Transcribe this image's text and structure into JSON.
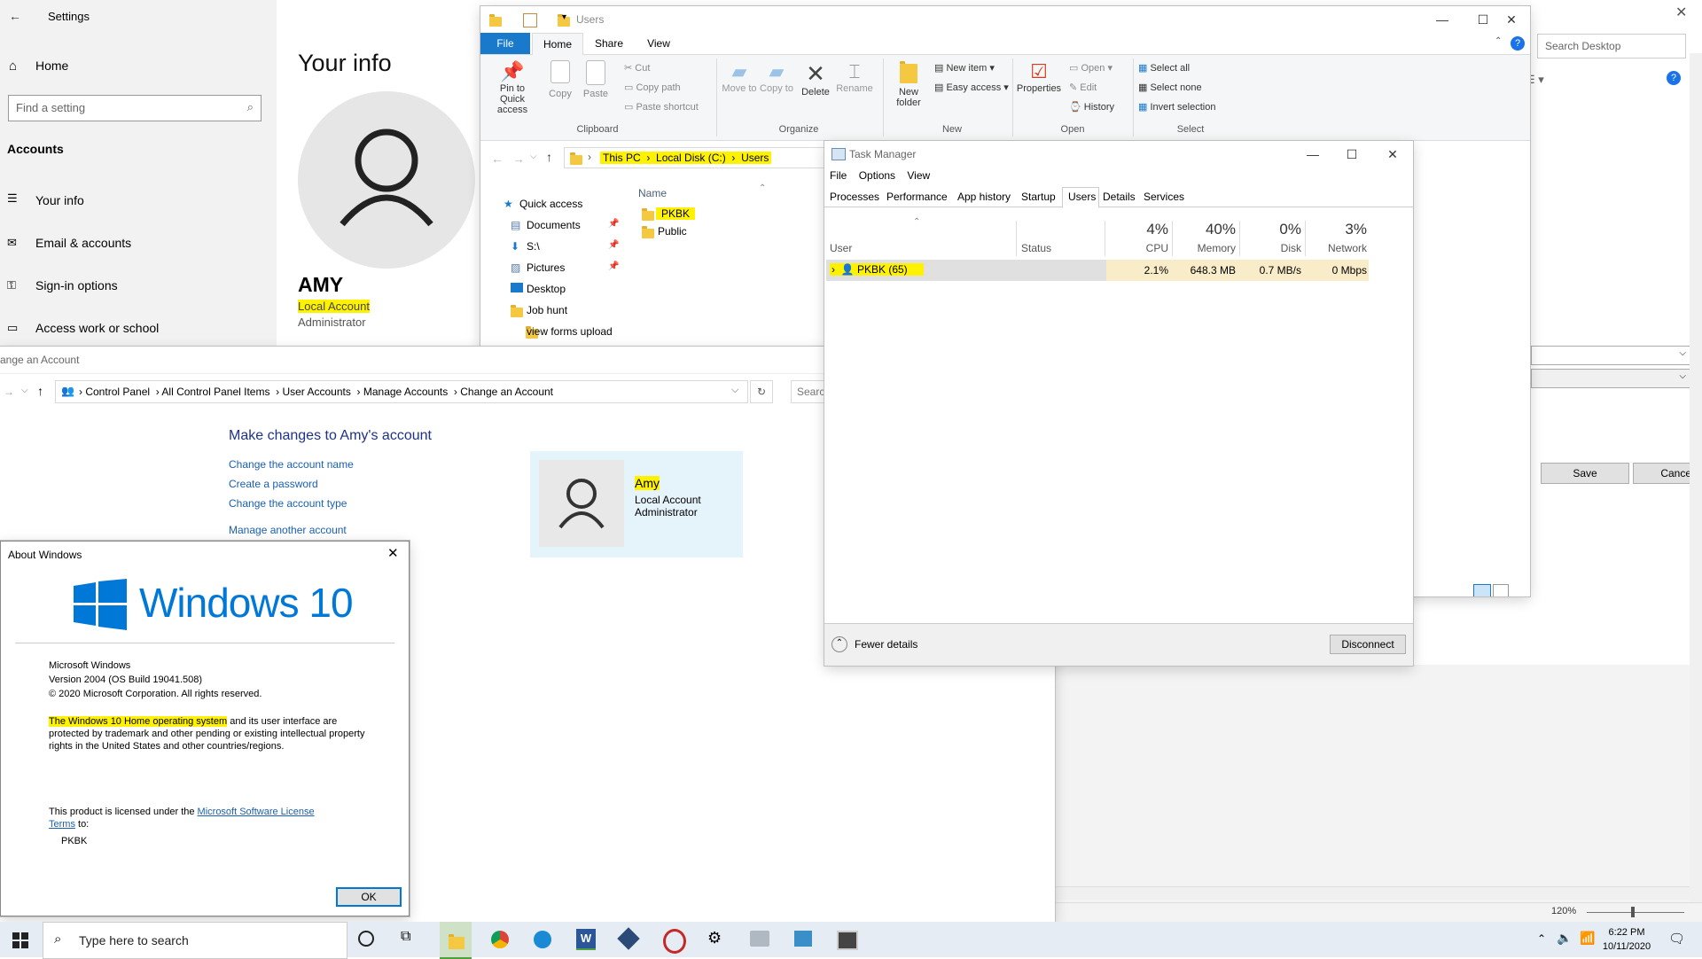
{
  "settings": {
    "title": "Settings",
    "home": "Home",
    "search_placeholder": "Find a setting",
    "section": "Accounts",
    "nav": [
      "Your info",
      "Email & accounts",
      "Sign-in options",
      "Access work or school"
    ],
    "page_title": "Your info",
    "user_name": "AMY",
    "account_type": "Local Account",
    "role": "Administrator"
  },
  "explorer": {
    "title": "Users",
    "tabs": [
      "File",
      "Home",
      "Share",
      "View"
    ],
    "ribbon": {
      "pin_label": "Pin to Quick access",
      "copy": "Copy",
      "paste": "Paste",
      "cut": "Cut",
      "copy_path": "Copy path",
      "paste_shortcut": "Paste shortcut",
      "clipboard_group": "Clipboard",
      "move_to": "Move to",
      "copy_to": "Copy to",
      "delete": "Delete",
      "rename": "Rename",
      "organize_group": "Organize",
      "new_folder": "New folder",
      "new_item": "New item",
      "easy_access": "Easy access",
      "new_group": "New",
      "properties": "Properties",
      "open": "Open",
      "edit": "Edit",
      "history": "History",
      "open_group": "Open",
      "select_all": "Select all",
      "select_none": "Select none",
      "invert_selection": "Invert selection",
      "select_group": "Select"
    },
    "breadcrumb": [
      "This PC",
      "Local Disk (C:)",
      "Users"
    ],
    "nav_pane": [
      "Quick access",
      "Documents",
      "S:\\",
      "Pictures",
      "Desktop",
      "Job hunt",
      "view forms upload"
    ],
    "column_name": "Name",
    "files": [
      "PKBK",
      "Public"
    ]
  },
  "cpanel": {
    "title": "ange an Account",
    "breadcrumb": [
      "Control Panel",
      "All Control Panel Items",
      "User Accounts",
      "Manage Accounts",
      "Change an Account"
    ],
    "search_placeholder": "Search",
    "heading": "Make changes to Amy's account",
    "links": [
      "Change the account name",
      "Create a password",
      "Change the account type",
      "Manage another account"
    ],
    "card_name": "Amy",
    "card_type": "Local Account",
    "card_role": "Administrator"
  },
  "taskmgr": {
    "title": "Task Manager",
    "menu": [
      "File",
      "Options",
      "View"
    ],
    "tabs": [
      "Processes",
      "Performance",
      "App history",
      "Startup",
      "Users",
      "Details",
      "Services"
    ],
    "active_tab": "Users",
    "col_user": "User",
    "col_status": "Status",
    "cpu_pct": "4%",
    "cpu_label": "CPU",
    "mem_pct": "40%",
    "mem_label": "Memory",
    "disk_pct": "0%",
    "disk_label": "Disk",
    "net_pct": "3%",
    "net_label": "Network",
    "row": {
      "user": "PKBK (65)",
      "cpu": "2.1%",
      "memory": "648.3 MB",
      "disk": "0.7 MB/s",
      "network": "0 Mbps"
    },
    "fewer_details": "Fewer details",
    "disconnect": "Disconnect"
  },
  "about": {
    "title": "About Windows",
    "logo_text": "Windows 10",
    "line1": "Microsoft Windows",
    "line2": "Version 2004 (OS Build 19041.508)",
    "line3": "© 2020 Microsoft Corporation. All rights reserved.",
    "para_hl": "The Windows 10 Home operating system",
    "para_rest1": " and its user interface are",
    "para_rest2": "protected by trademark and other pending or existing intellectual property",
    "para_rest3": "rights in the United States and other countries/regions.",
    "license_pre": "This product is licensed under the ",
    "license_link1": "Microsoft Software License",
    "license_link2": "Terms",
    "license_post": " to:",
    "licensee": "PKBK",
    "ok": "OK"
  },
  "word": {
    "search_placeholder": "Search Desktop",
    "save": "Save",
    "cancel": "Cancel",
    "zoom": "120%"
  },
  "taskbar": {
    "search_placeholder": "Type here to search",
    "time": "6:22 PM",
    "date": "10/11/2020",
    "word_icon_letter": "W"
  },
  "colors": {
    "accent": "#0063b1",
    "highlight": "#fff200",
    "link": "#1a5fb4"
  }
}
